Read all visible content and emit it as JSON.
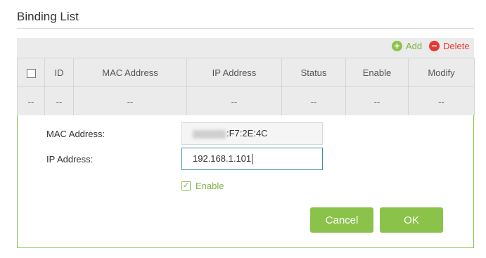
{
  "section": {
    "title": "Binding List"
  },
  "toolbar": {
    "add_label": "Add",
    "add_icon": "+",
    "delete_label": "Delete",
    "delete_icon": "−"
  },
  "table": {
    "columns": [
      "ID",
      "MAC Address",
      "IP Address",
      "Status",
      "Enable",
      "Modify"
    ],
    "placeholder_row": [
      "--",
      "--",
      "--",
      "--",
      "--",
      "--",
      "--"
    ]
  },
  "form": {
    "mac_label": "MAC Address:",
    "mac_value_suffix": ":F7:2E:4C",
    "ip_label": "IP Address:",
    "ip_value": "192.168.1.101",
    "enable_label": "Enable",
    "enable_checked": true,
    "enable_check_glyph": "✓",
    "cancel_label": "Cancel",
    "ok_label": "OK"
  },
  "colors": {
    "accent": "#8bc34a",
    "danger": "#e53935",
    "focus": "#3a8fb7"
  }
}
